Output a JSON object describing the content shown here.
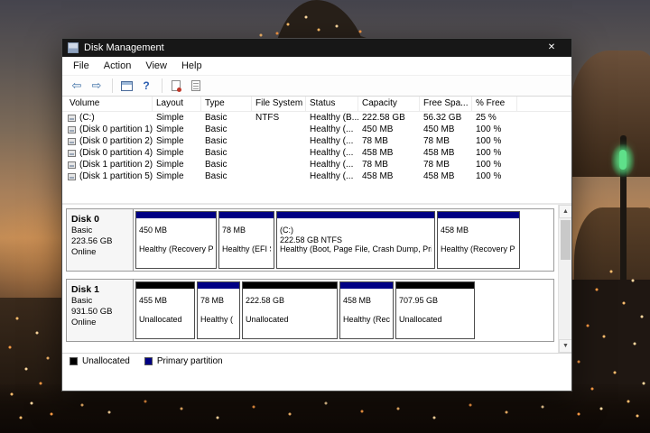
{
  "colors": {
    "titlebar": "#171717",
    "primary-partition": "#000084",
    "unallocated": "#000000"
  },
  "window": {
    "title": "Disk Management",
    "close_glyph": "✕",
    "menus": [
      "File",
      "Action",
      "View",
      "Help"
    ]
  },
  "toolbar": {
    "back": "⇦",
    "forward": "⇨",
    "help": "?"
  },
  "scrollbar": {
    "up": "▲",
    "down": "▼"
  },
  "list": {
    "columns": [
      "Volume",
      "Layout",
      "Type",
      "File System",
      "Status",
      "Capacity",
      "Free Spa...",
      "% Free"
    ],
    "rows": [
      {
        "volume": "(C:)",
        "layout": "Simple",
        "type": "Basic",
        "fs": "NTFS",
        "status": "Healthy (B...",
        "capacity": "222.58 GB",
        "free": "56.32 GB",
        "pct": "25 %"
      },
      {
        "volume": "(Disk 0 partition 1)",
        "layout": "Simple",
        "type": "Basic",
        "fs": "",
        "status": "Healthy (...",
        "capacity": "450 MB",
        "free": "450 MB",
        "pct": "100 %"
      },
      {
        "volume": "(Disk 0 partition 2)",
        "layout": "Simple",
        "type": "Basic",
        "fs": "",
        "status": "Healthy (...",
        "capacity": "78 MB",
        "free": "78 MB",
        "pct": "100 %"
      },
      {
        "volume": "(Disk 0 partition 4)",
        "layout": "Simple",
        "type": "Basic",
        "fs": "",
        "status": "Healthy (...",
        "capacity": "458 MB",
        "free": "458 MB",
        "pct": "100 %"
      },
      {
        "volume": "(Disk 1 partition 2)",
        "layout": "Simple",
        "type": "Basic",
        "fs": "",
        "status": "Healthy (...",
        "capacity": "78 MB",
        "free": "78 MB",
        "pct": "100 %"
      },
      {
        "volume": "(Disk 1 partition 5)",
        "layout": "Simple",
        "type": "Basic",
        "fs": "",
        "status": "Healthy (...",
        "capacity": "458 MB",
        "free": "458 MB",
        "pct": "100 %"
      }
    ]
  },
  "disks": [
    {
      "name": "Disk 0",
      "type": "Basic",
      "size": "223.56 GB",
      "status": "Online",
      "partitions": [
        {
          "line1": "450 MB",
          "line2": "",
          "line3": "Healthy (Recovery P",
          "kind": "primary"
        },
        {
          "line1": "78 MB",
          "line2": "",
          "line3": "Healthy (EFI S",
          "kind": "primary"
        },
        {
          "line1": "(C:)",
          "line2": "222.58 GB NTFS",
          "line3": "Healthy (Boot, Page File, Crash Dump, Prin",
          "kind": "primary"
        },
        {
          "line1": "458 MB",
          "line2": "",
          "line3": "Healthy (Recovery P",
          "kind": "primary"
        }
      ]
    },
    {
      "name": "Disk 1",
      "type": "Basic",
      "size": "931.50 GB",
      "status": "Online",
      "partitions": [
        {
          "line1": "455 MB",
          "line2": "",
          "line3": "Unallocated",
          "kind": "unallocated"
        },
        {
          "line1": "78 MB",
          "line2": "",
          "line3": "Healthy (",
          "kind": "primary"
        },
        {
          "line1": "222.58 GB",
          "line2": "",
          "line3": "Unallocated",
          "kind": "unallocated"
        },
        {
          "line1": "458 MB",
          "line2": "",
          "line3": "Healthy (Reco",
          "kind": "primary"
        },
        {
          "line1": "707.95 GB",
          "line2": "",
          "line3": "Unallocated",
          "kind": "unallocated"
        }
      ]
    }
  ],
  "legend": [
    {
      "label": "Unallocated"
    },
    {
      "label": "Primary partition"
    }
  ]
}
